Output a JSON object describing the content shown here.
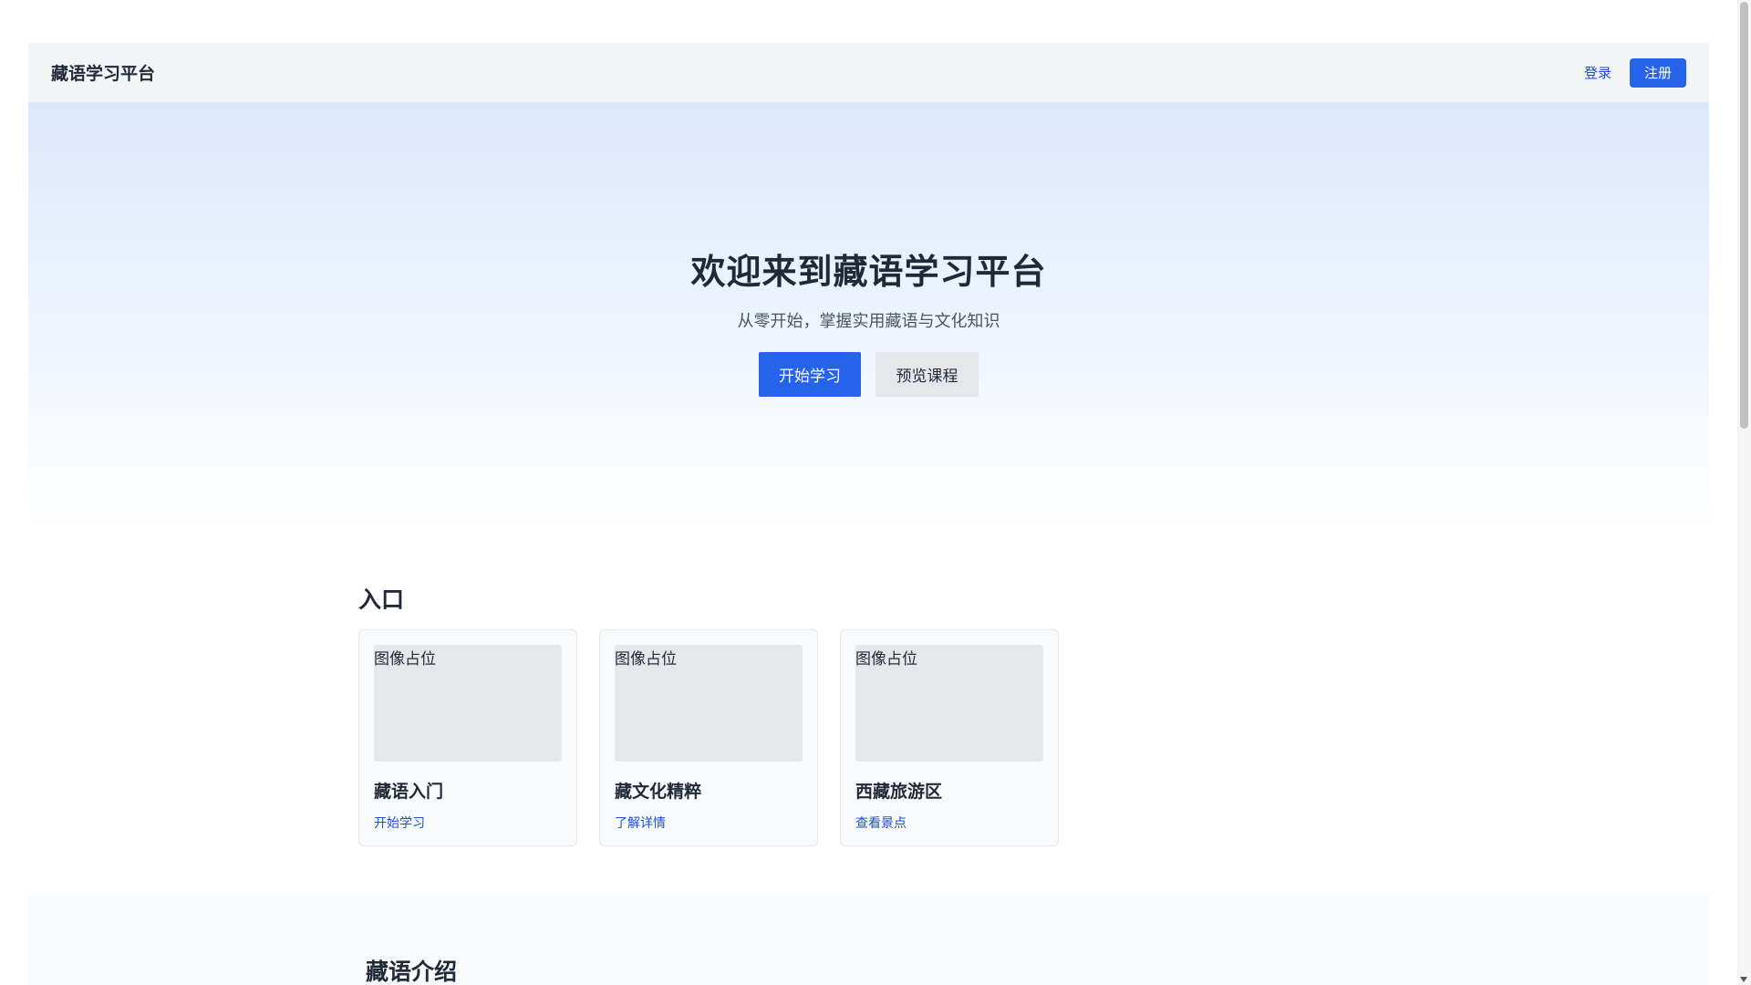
{
  "header": {
    "brand": "藏语学习平台",
    "login_label": "登录",
    "register_label": "注册"
  },
  "hero": {
    "title": "欢迎来到藏语学习平台",
    "subtitle": "从零开始，掌握实用藏语与文化知识",
    "primary_button": "开始学习",
    "secondary_button": "预览课程"
  },
  "entry": {
    "title": "入口",
    "cards": [
      {
        "image_label": "图像占位",
        "title": "藏语入门",
        "link": "开始学习"
      },
      {
        "image_label": "图像占位",
        "title": "藏文化精粹",
        "link": "了解详情"
      },
      {
        "image_label": "图像占位",
        "title": "西藏旅游区",
        "link": "查看景点"
      }
    ]
  },
  "intro": {
    "title": "藏语介绍"
  },
  "colors": {
    "accent": "#2563eb",
    "link": "#1d4ed8",
    "header_bg": "#f3f4f6",
    "hero_gradient_top": "#dbe8fb"
  }
}
